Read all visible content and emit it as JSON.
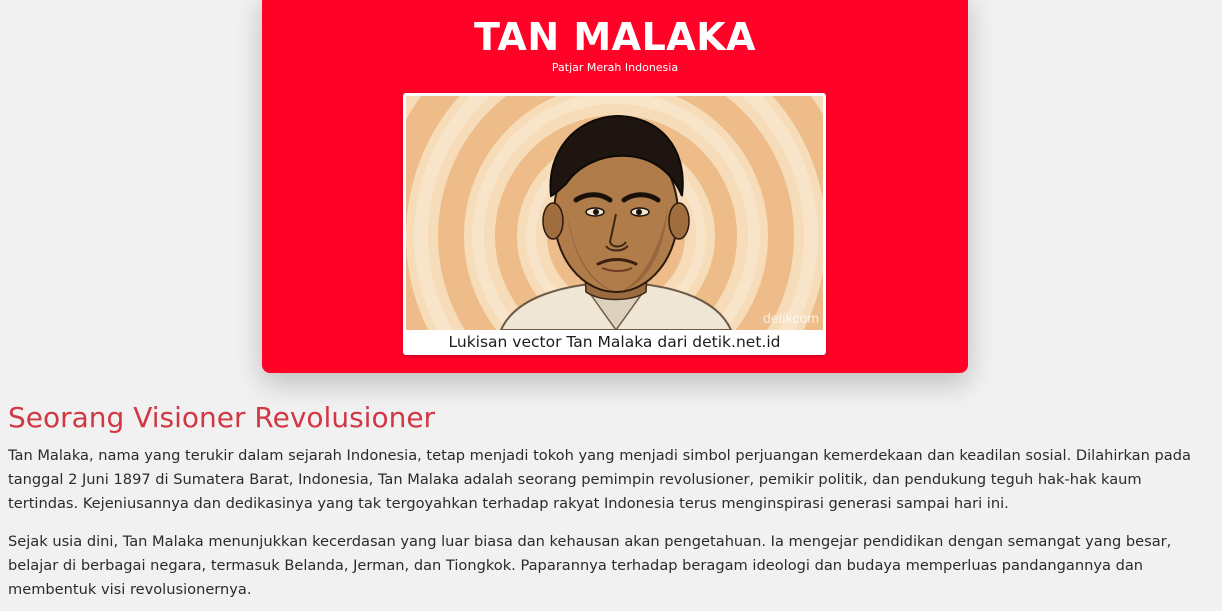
{
  "hero": {
    "title": "TAN MALAKA",
    "subtitle": "Patjar Merah Indonesia",
    "background_color": "#ff0228",
    "image_caption": "Lukisan vector Tan Malaka dari detik.net.id",
    "image_watermark": "detikcom"
  },
  "article": {
    "heading": "Seorang Visioner Revolusioner",
    "heading_color": "#d23744",
    "paragraphs": [
      "Tan Malaka, nama yang terukir dalam sejarah Indonesia, tetap menjadi tokoh yang menjadi simbol perjuangan kemerdekaan dan keadilan sosial. Dilahirkan pada tanggal 2 Juni 1897 di Sumatera Barat, Indonesia, Tan Malaka adalah seorang pemimpin revolusioner, pemikir politik, dan pendukung teguh hak-hak kaum tertindas. Kejeniusannya dan dedikasinya yang tak tergoyahkan terhadap rakyat Indonesia terus menginspirasi generasi sampai hari ini.",
      "Sejak usia dini, Tan Malaka menunjukkan kecerdasan yang luar biasa dan kehausan akan pengetahuan. Ia mengejar pendidikan dengan semangat yang besar, belajar di berbagai negara, termasuk Belanda, Jerman, dan Tiongkok. Paparannya terhadap beragam ideologi dan budaya memperluas pandangannya dan membentuk visi revolusionernya."
    ]
  }
}
